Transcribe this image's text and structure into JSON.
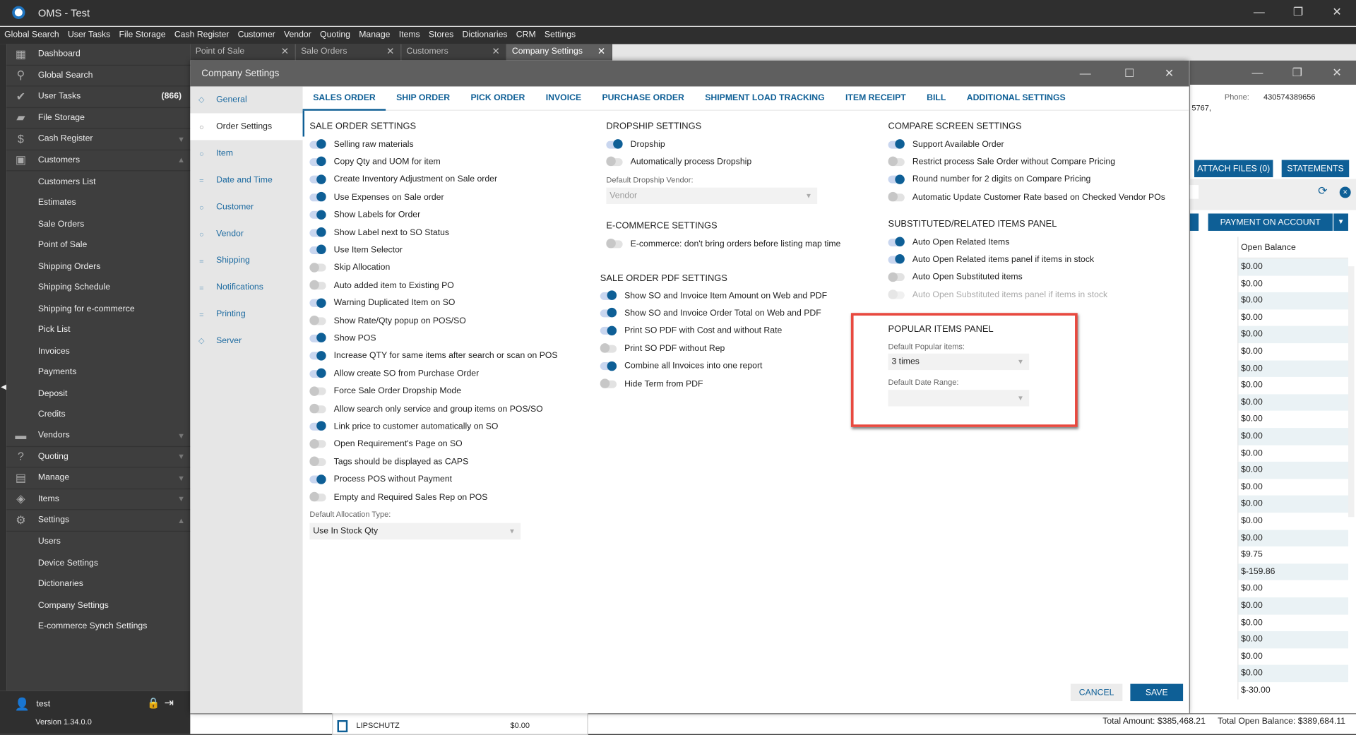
{
  "app": {
    "title": "OMS - Test"
  },
  "menu": [
    "Global Search",
    "User Tasks",
    "File Storage",
    "Cash Register",
    "Customer",
    "Vendor",
    "Quoting",
    "Manage",
    "Items",
    "Stores",
    "Dictionaries",
    "CRM",
    "Settings"
  ],
  "sidebar": {
    "items": [
      {
        "label": "Dashboard",
        "icon": "dashboard-icon",
        "glyph": "▦"
      },
      {
        "label": "Global Search",
        "icon": "search-icon",
        "glyph": "⚲"
      },
      {
        "label": "User Tasks",
        "icon": "check-circle-icon",
        "glyph": "✔",
        "badge": "(866)"
      },
      {
        "label": "File Storage",
        "icon": "folder-icon",
        "glyph": "▰"
      },
      {
        "label": "Cash Register",
        "icon": "dollar-icon",
        "glyph": "$",
        "chev": "⌄"
      },
      {
        "label": "Customers",
        "icon": "contact-icon",
        "glyph": "▣",
        "chev": "⌃"
      },
      {
        "label": "Customers List",
        "sub": true
      },
      {
        "label": "Estimates",
        "sub": true
      },
      {
        "label": "Sale Orders",
        "sub": true
      },
      {
        "label": "Point of Sale",
        "sub": true
      },
      {
        "label": "Shipping Orders",
        "sub": true
      },
      {
        "label": "Shipping Schedule",
        "sub": true
      },
      {
        "label": "Shipping for e-commerce",
        "sub": true
      },
      {
        "label": "Pick List",
        "sub": true
      },
      {
        "label": "Invoices",
        "sub": true
      },
      {
        "label": "Payments",
        "sub": true
      },
      {
        "label": "Deposit",
        "sub": true
      },
      {
        "label": "Credits",
        "sub": true
      },
      {
        "label": "Vendors",
        "icon": "truck-icon",
        "glyph": "▬",
        "chev": "⌄"
      },
      {
        "label": "Quoting",
        "icon": "quote-icon",
        "glyph": "?",
        "chev": "⌄"
      },
      {
        "label": "Manage",
        "icon": "clipboard-icon",
        "glyph": "▤",
        "chev": "⌄"
      },
      {
        "label": "Items",
        "icon": "tag-icon",
        "glyph": "◈",
        "chev": "⌄"
      },
      {
        "label": "Settings",
        "icon": "gear-icon",
        "glyph": "⚙",
        "chev": "⌃"
      },
      {
        "label": "Users",
        "sub": true
      },
      {
        "label": "Device Settings",
        "sub": true
      },
      {
        "label": "Dictionaries",
        "sub": true
      },
      {
        "label": "Company Settings",
        "sub": true
      },
      {
        "label": "E-commerce Synch Settings",
        "sub": true
      }
    ],
    "user": "test",
    "version": "Version 1.34.0.0"
  },
  "doc_tabs": [
    {
      "label": "Point of Sale"
    },
    {
      "label": "Sale Orders"
    },
    {
      "label": "Customers"
    },
    {
      "label": "Company Settings",
      "active": true
    }
  ],
  "customer_window": {
    "phone_label": "Phone:",
    "phone": "430574389656",
    "address_fragment": "5767,",
    "attach_files": "ATTACH FILES (0)",
    "statements": "STATEMENTS",
    "payment_on_account": "PAYMENT ON ACCOUNT",
    "column": "Open Balance",
    "balances": [
      "$0.00",
      "$0.00",
      "$0.00",
      "$0.00",
      "$0.00",
      "$0.00",
      "$0.00",
      "$0.00",
      "$0.00",
      "$0.00",
      "$0.00",
      "$0.00",
      "$0.00",
      "$0.00",
      "$0.00",
      "$0.00",
      "$0.00",
      "$9.75",
      "$-159.86",
      "$0.00",
      "$0.00",
      "$0.00",
      "$0.00",
      "$0.00",
      "$0.00",
      "$-30.00"
    ],
    "total_amount": "Total Amount: $385,468.21",
    "total_open_balance": "Total Open Balance: $389,684.11",
    "bottom_row": {
      "name": "LIPSCHUTZ",
      "amount": "$0.00"
    }
  },
  "modal": {
    "title": "Company Settings",
    "nav": [
      {
        "label": "General",
        "glyph": "◇"
      },
      {
        "label": "Order Settings",
        "glyph": "○",
        "active": true
      },
      {
        "label": "Item",
        "glyph": "○"
      },
      {
        "label": "Date and Time",
        "glyph": "="
      },
      {
        "label": "Customer",
        "glyph": "○"
      },
      {
        "label": "Vendor",
        "glyph": "○"
      },
      {
        "label": "Shipping",
        "glyph": "="
      },
      {
        "label": "Notifications",
        "glyph": "="
      },
      {
        "label": "Printing",
        "glyph": "="
      },
      {
        "label": "Server",
        "glyph": "◇"
      }
    ],
    "tabs": [
      {
        "label": "SALES ORDER",
        "active": true
      },
      {
        "label": "SHIP ORDER"
      },
      {
        "label": "PICK ORDER"
      },
      {
        "label": "INVOICE"
      },
      {
        "label": "PURCHASE ORDER"
      },
      {
        "label": "SHIPMENT LOAD TRACKING"
      },
      {
        "label": "ITEM RECEIPT"
      },
      {
        "label": "BILL"
      },
      {
        "label": "ADDITIONAL SETTINGS"
      }
    ],
    "sale_order": {
      "title": "SALE ORDER SETTINGS",
      "toggles": [
        {
          "label": "Selling raw materials",
          "on": true
        },
        {
          "label": "Copy Qty and UOM for item",
          "on": true
        },
        {
          "label": "Create Inventory Adjustment on Sale order",
          "on": true
        },
        {
          "label": "Use Expenses on Sale order",
          "on": true
        },
        {
          "label": "Show Labels for Order",
          "on": true
        },
        {
          "label": "Show Label next to SO Status",
          "on": true
        },
        {
          "label": "Use Item Selector",
          "on": true
        },
        {
          "label": "Skip Allocation",
          "on": false
        },
        {
          "label": "Auto added item to Existing PO",
          "on": false
        },
        {
          "label": "Warning Duplicated Item on SO",
          "on": true
        },
        {
          "label": "Show Rate/Qty popup on POS/SO",
          "on": false
        },
        {
          "label": "Show POS",
          "on": true
        },
        {
          "label": "Increase QTY for same items after search or scan on POS",
          "on": true
        },
        {
          "label": "Allow create SO from Purchase Order",
          "on": true
        },
        {
          "label": "Force Sale Order Dropship Mode",
          "on": false
        },
        {
          "label": "Allow search only service and group items on POS/SO",
          "on": false
        },
        {
          "label": "Link price to customer automatically on SO",
          "on": true
        },
        {
          "label": "Open Requirement's Page on SO",
          "on": false
        },
        {
          "label": "Tags should be displayed as CAPS",
          "on": false
        },
        {
          "label": "Process POS without Payment",
          "on": true
        },
        {
          "label": "Empty and Required Sales Rep on POS",
          "on": false
        }
      ],
      "allocation_label": "Default Allocation Type:",
      "allocation_value": "Use In Stock Qty"
    },
    "dropship": {
      "title": "DROPSHIP SETTINGS",
      "toggles": [
        {
          "label": "Dropship",
          "on": true
        },
        {
          "label": "Automatically process Dropship",
          "on": false
        }
      ],
      "vendor_label": "Default Dropship Vendor:",
      "vendor_placeholder": "Vendor"
    },
    "ecommerce": {
      "title": "E-COMMERCE SETTINGS",
      "toggles": [
        {
          "label": "E-commerce: don't bring orders before listing map time",
          "on": false
        }
      ]
    },
    "pdf": {
      "title": "SALE ORDER PDF SETTINGS",
      "toggles": [
        {
          "label": "Show SO and Invoice Item Amount on Web and PDF",
          "on": true
        },
        {
          "label": "Show SO and Invoice Order Total on Web and PDF",
          "on": true
        },
        {
          "label": "Print SO PDF with Cost and without Rate",
          "on": true
        },
        {
          "label": "Print SO PDF without Rep",
          "on": false
        },
        {
          "label": "Combine all Invoices into one report",
          "on": true
        },
        {
          "label": "Hide Term from PDF",
          "on": false
        }
      ]
    },
    "compare": {
      "title": "COMPARE SCREEN SETTINGS",
      "toggles": [
        {
          "label": "Support Available Order",
          "on": true
        },
        {
          "label": "Restrict process Sale Order without Compare Pricing",
          "on": false
        },
        {
          "label": "Round number for 2 digits on Compare Pricing",
          "on": true
        },
        {
          "label": "Automatic Update Customer Rate based on Checked Vendor POs",
          "on": false
        }
      ]
    },
    "substituted": {
      "title": "SUBSTITUTED/RELATED ITEMS PANEL",
      "toggles": [
        {
          "label": "Auto Open Related Items",
          "on": true
        },
        {
          "label": "Auto Open Related items panel if items in stock",
          "on": true
        },
        {
          "label": "Auto Open Substituted items",
          "on": false
        },
        {
          "label": "Auto Open Substituted items panel if items in stock",
          "on": false,
          "disabled": true
        }
      ]
    },
    "popular": {
      "title": "POPULAR ITEMS PANEL",
      "items_label": "Default Popular items:",
      "items_value": "3 times",
      "range_label": "Default Date Range:",
      "range_value": ""
    },
    "cancel": "CANCEL",
    "save": "SAVE"
  },
  "colors": {
    "accent": "#0e5f96",
    "highlight": "#e8493f"
  }
}
